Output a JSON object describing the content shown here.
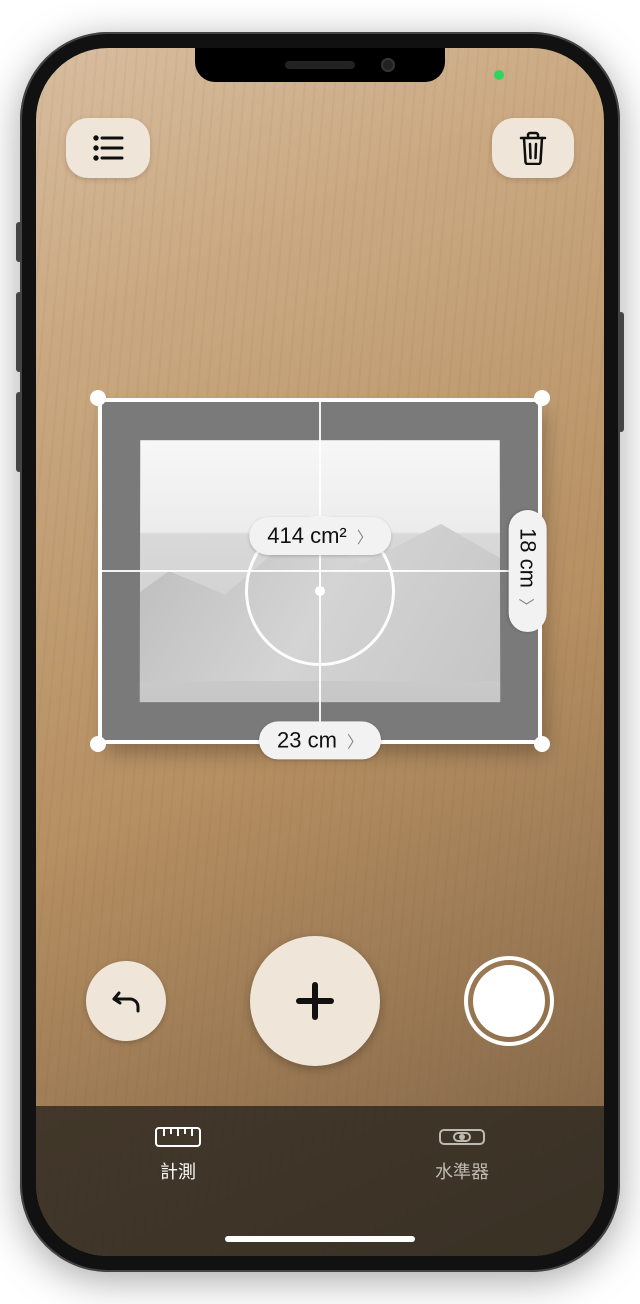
{
  "measurements": {
    "area": "414 cm²",
    "width": "23 cm",
    "height": "18 cm"
  },
  "icons": {
    "list": "list-icon",
    "trash": "trash-icon",
    "undo": "undo-icon",
    "plus": "plus-icon",
    "shutter": "shutter-icon"
  },
  "tabs": {
    "measure": "計測",
    "level": "水準器"
  },
  "active_tab": "measure"
}
